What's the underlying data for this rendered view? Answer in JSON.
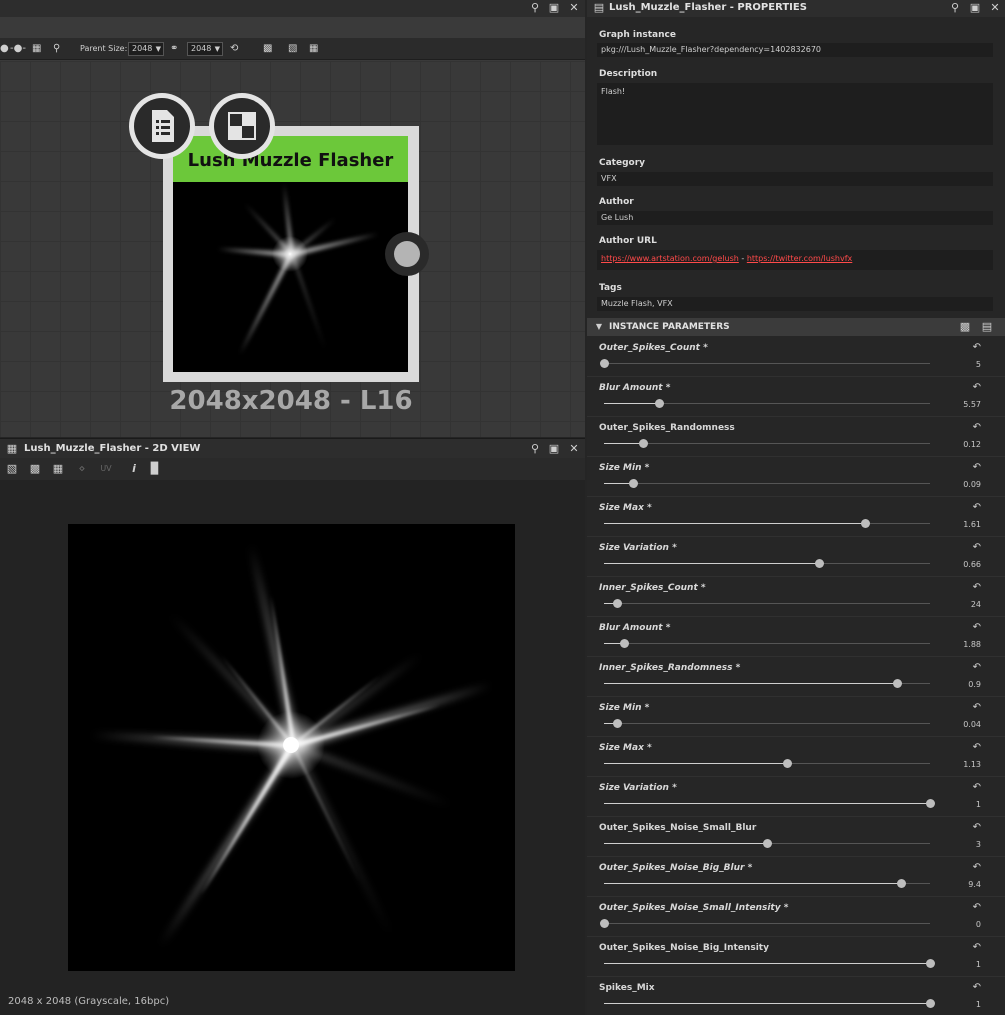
{
  "graph_toolbar": {
    "parent_size_label": "Parent Size:",
    "size_a": "2048",
    "size_b": "2048"
  },
  "node": {
    "title": "Lush Muzzle Flasher",
    "resolution": "2048x2048 - L16",
    "header_color": "#6cc83a"
  },
  "view_panel": {
    "title": "Lush_Muzzle_Flasher - 2D VIEW",
    "uv_label": "UV",
    "status": "2048 x 2048 (Grayscale, 16bpc)"
  },
  "props": {
    "title": "Lush_Muzzle_Flasher - PROPERTIES",
    "graph_instance_label": "Graph instance",
    "graph_instance_value": "pkg:///Lush_Muzzle_Flasher?dependency=1402832670",
    "description_label": "Description",
    "description_value": "Flash!",
    "category_label": "Category",
    "category_value": "VFX",
    "author_label": "Author",
    "author_value": "Ge Lush",
    "author_url_label": "Author URL",
    "author_url_1": "https://www.artstation.com/gelush",
    "author_url_sep": " - ",
    "author_url_2": "https://twitter.com/lushvfx",
    "tags_label": "Tags",
    "tags_value": "Muzzle Flash, VFX",
    "instance_params_label": "INSTANCE PARAMETERS"
  },
  "params": [
    {
      "name": "Outer_Spikes_Count *",
      "value": "5",
      "fraction": 0.0,
      "italic": true
    },
    {
      "name": "Blur Amount *",
      "value": "5.57",
      "fraction": 0.17,
      "italic": true
    },
    {
      "name": "Outer_Spikes_Randomness",
      "value": "0.12",
      "fraction": 0.12,
      "italic": false
    },
    {
      "name": "Size Min *",
      "value": "0.09",
      "fraction": 0.09,
      "italic": true
    },
    {
      "name": "Size Max *",
      "value": "1.61",
      "fraction": 0.8,
      "italic": true
    },
    {
      "name": "Size Variation *",
      "value": "0.66",
      "fraction": 0.66,
      "italic": true
    },
    {
      "name": "Inner_Spikes_Count *",
      "value": "24",
      "fraction": 0.04,
      "italic": true
    },
    {
      "name": "Blur Amount *",
      "value": "1.88",
      "fraction": 0.06,
      "italic": true
    },
    {
      "name": "Inner_Spikes_Randomness *",
      "value": "0.9",
      "fraction": 0.9,
      "italic": true
    },
    {
      "name": "Size Min *",
      "value": "0.04",
      "fraction": 0.04,
      "italic": true
    },
    {
      "name": "Size Max *",
      "value": "1.13",
      "fraction": 0.56,
      "italic": true
    },
    {
      "name": "Size Variation *",
      "value": "1",
      "fraction": 1.0,
      "italic": true
    },
    {
      "name": "Outer_Spikes_Noise_Small_Blur",
      "value": "3",
      "fraction": 0.5,
      "italic": false
    },
    {
      "name": "Outer_Spikes_Noise_Big_Blur *",
      "value": "9.4",
      "fraction": 0.91,
      "italic": true
    },
    {
      "name": "Outer_Spikes_Noise_Small_Intensity *",
      "value": "0",
      "fraction": 0.0,
      "italic": true
    },
    {
      "name": "Outer_Spikes_Noise_Big_Intensity",
      "value": "1",
      "fraction": 1.0,
      "italic": false
    },
    {
      "name": "Spikes_Mix",
      "value": "1",
      "fraction": 1.0,
      "italic": false
    }
  ]
}
